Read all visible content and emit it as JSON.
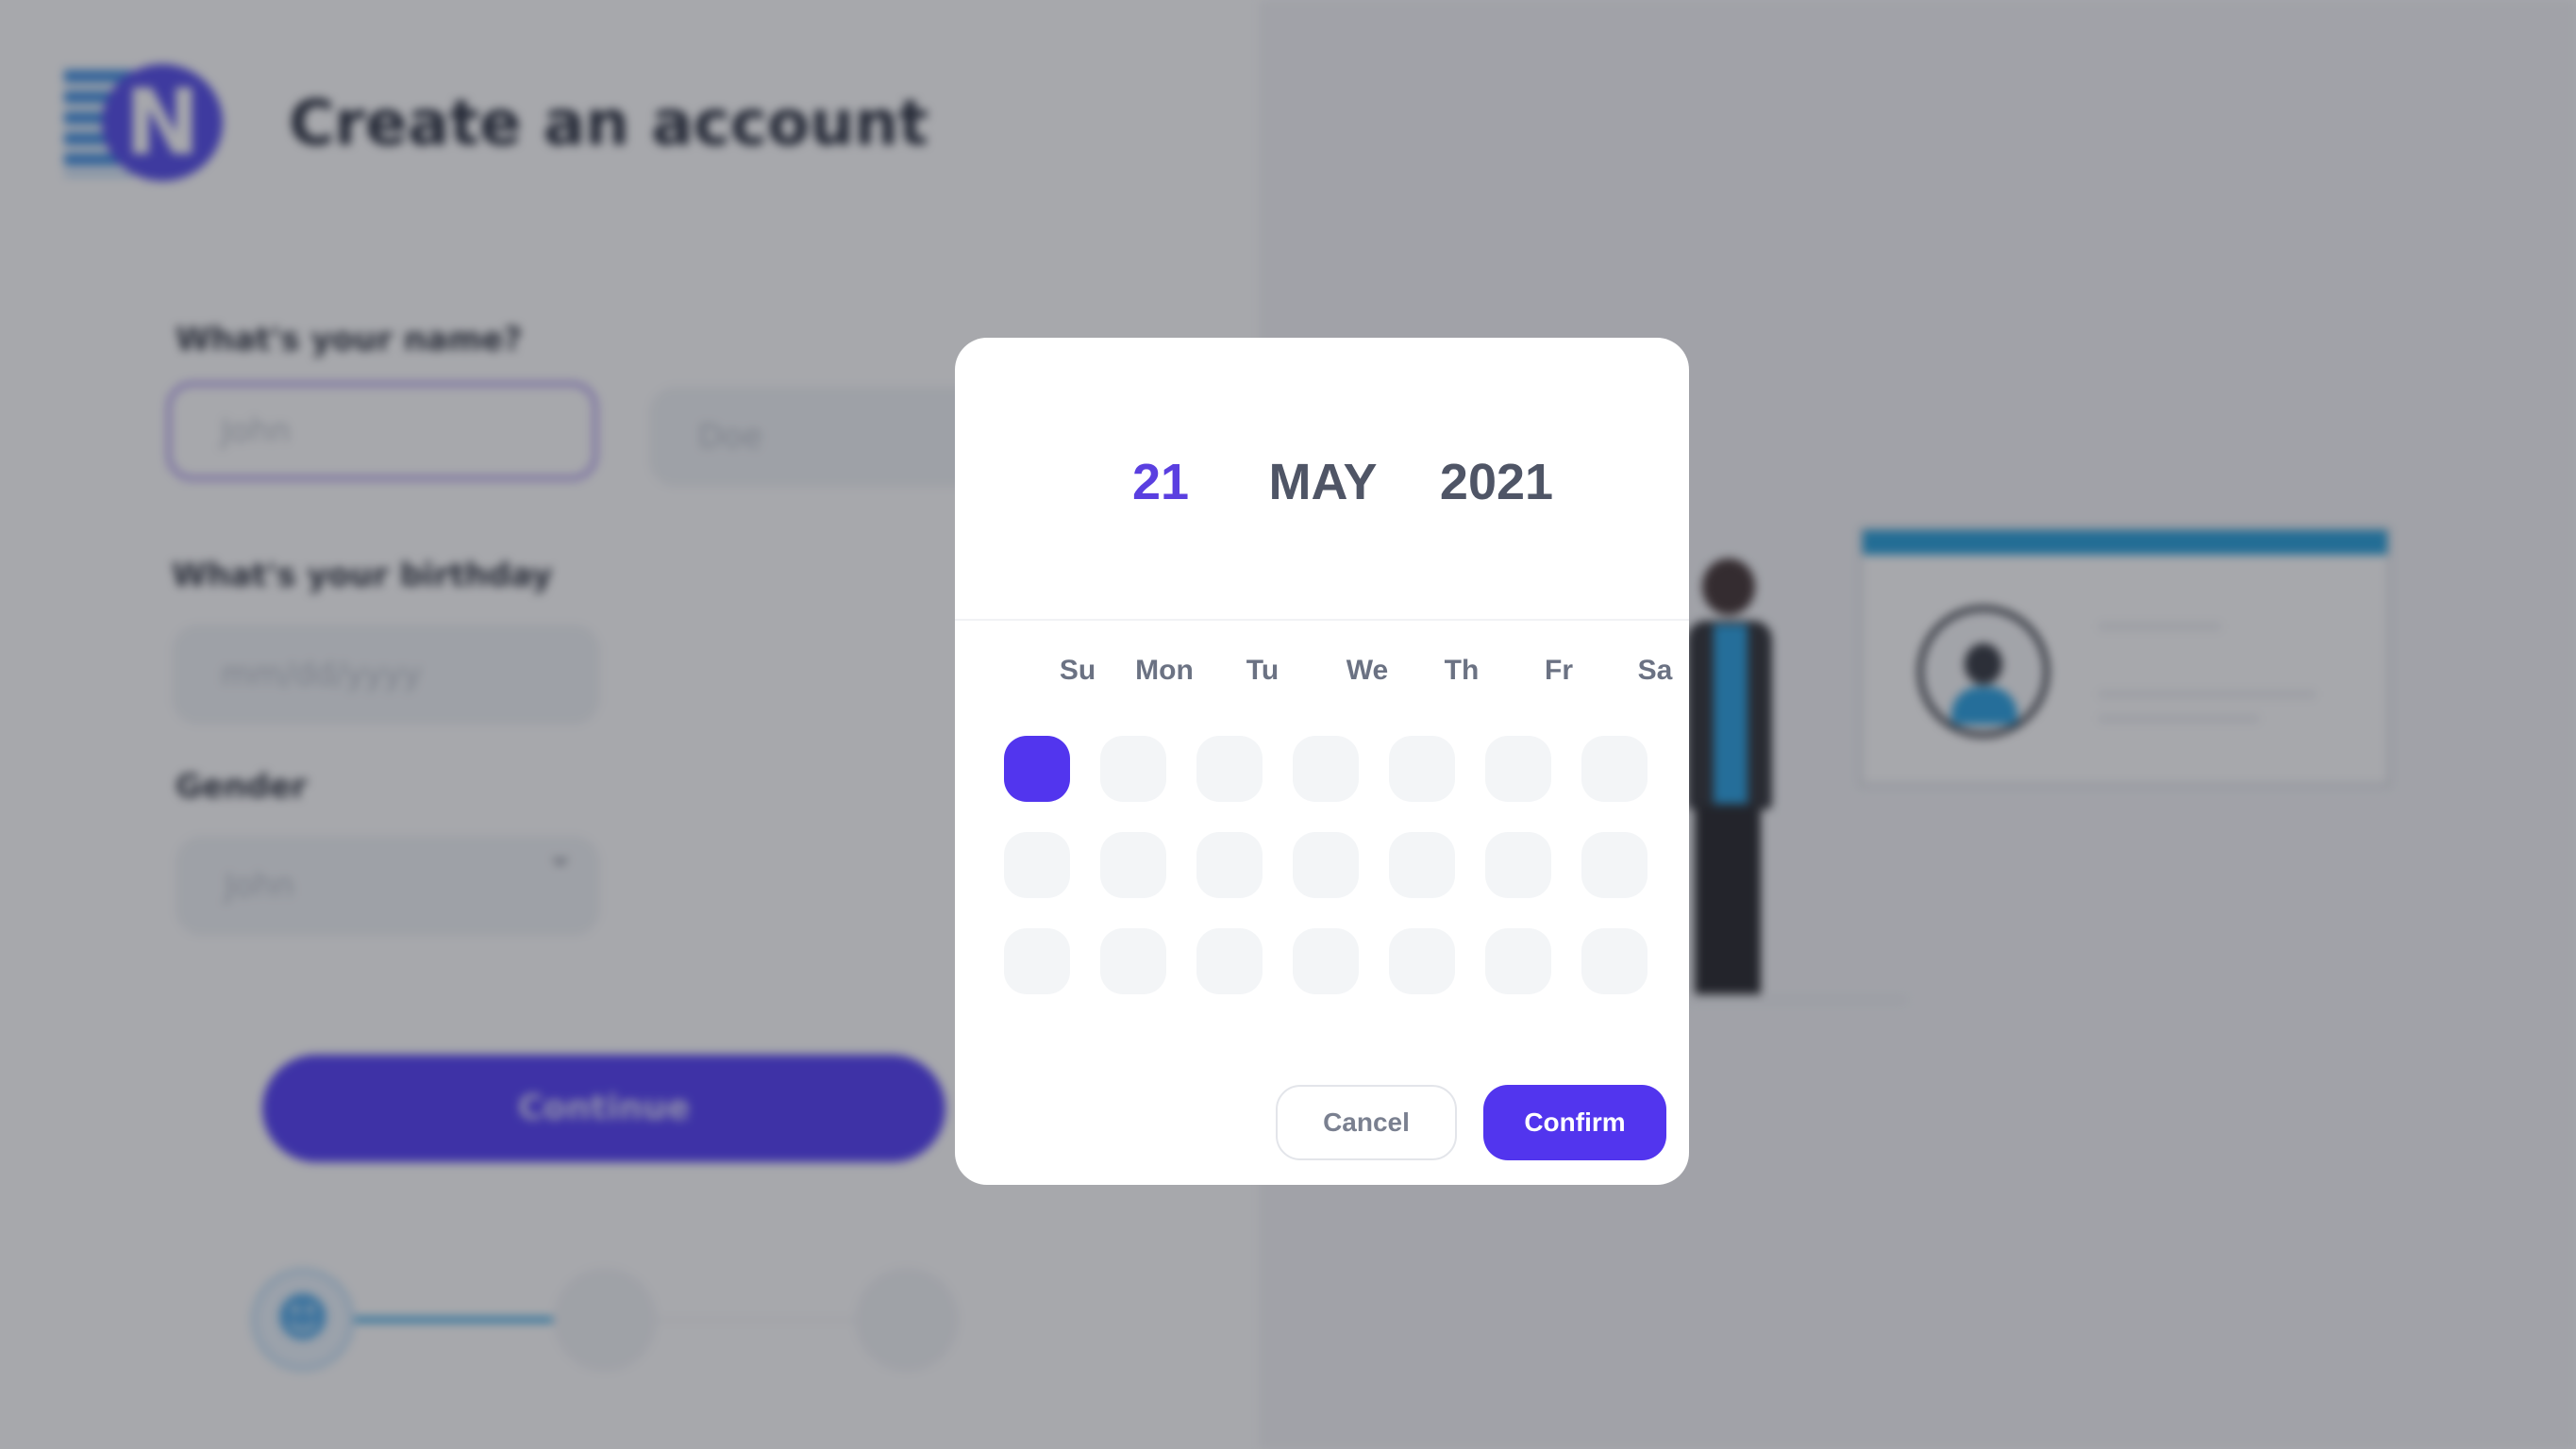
{
  "page": {
    "title": "Create an account",
    "logo_letter": "N",
    "name_label": "What's your name?",
    "first_name_placeholder": "John",
    "last_name_placeholder": "Doe",
    "birthday_label": "What's your birthday",
    "birthday_placeholder": "mm/dd/yyyy",
    "gender_label": "Gender",
    "gender_value": "John",
    "continue_label": "Continue",
    "steps_completed_fraction": 0.33
  },
  "date_picker": {
    "day": "21",
    "month": "MAY",
    "year": "2021",
    "weekdays": [
      "Su",
      "Mon",
      "Tu",
      "We",
      "Th",
      "Fr",
      "Sa"
    ],
    "rows": 3,
    "selected_cell": "row 1, Su",
    "cancel_label": "Cancel",
    "confirm_label": "Confirm"
  },
  "colors": {
    "accent": "#5235ee",
    "continue_button": "#4a35f5",
    "overlay": "#2d303a",
    "day_text": "#5a3fe0",
    "month_year_text": "#4f5566"
  },
  "icons": {
    "step_1": "user-icon",
    "gender_dropdown": "chevron-down-icon"
  }
}
